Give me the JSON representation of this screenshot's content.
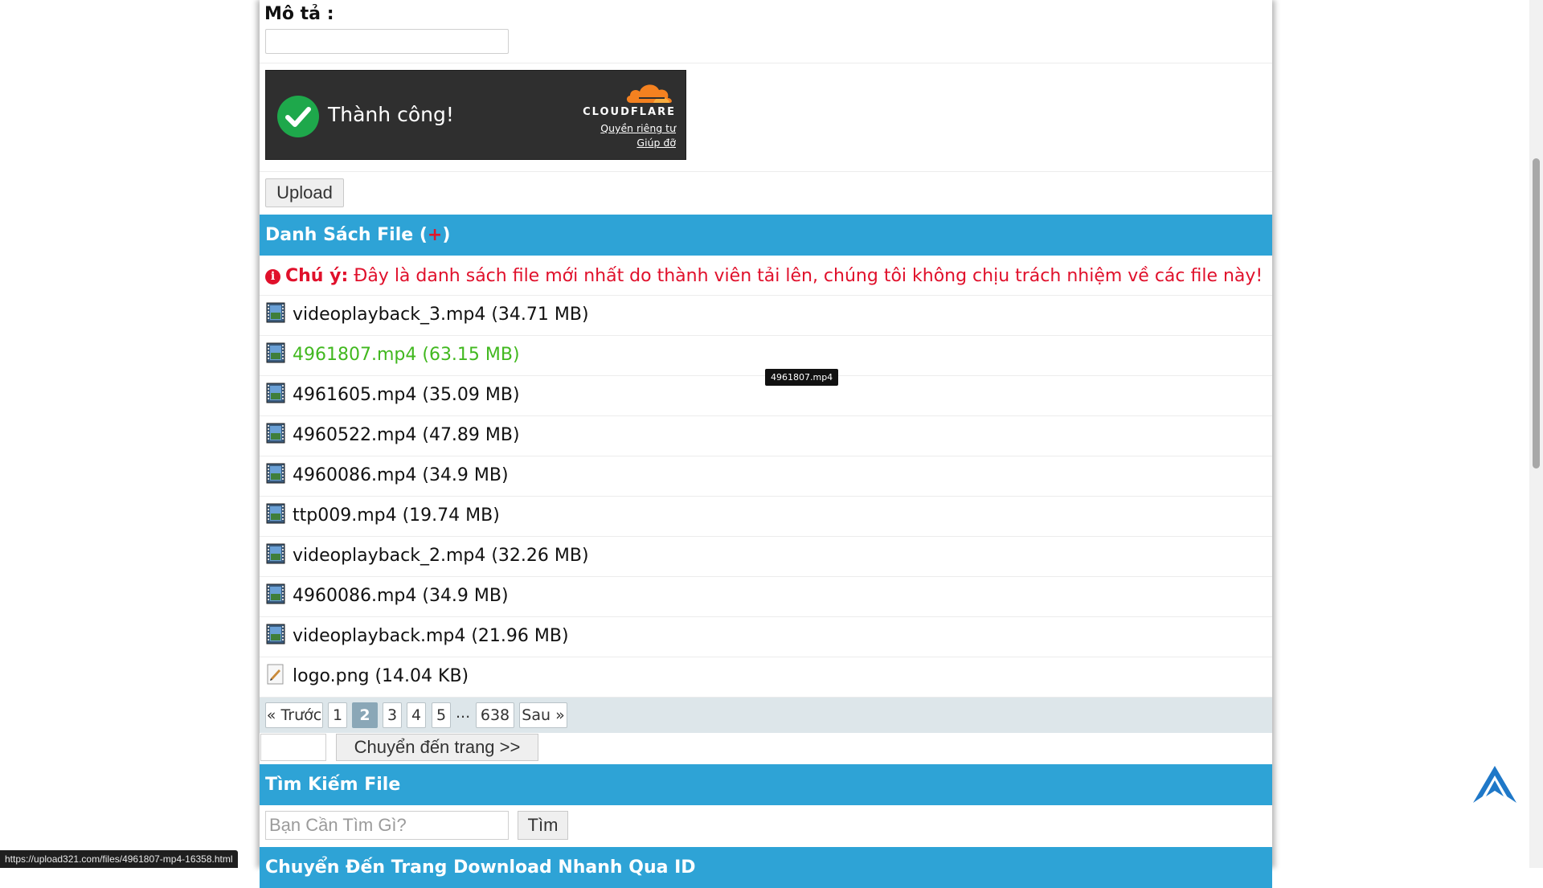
{
  "form": {
    "description_label": "Mô tả :",
    "description_value": "",
    "upload_label": "Upload"
  },
  "captcha": {
    "status": "Thành công!",
    "brand": "CLOUDFLARE",
    "privacy_link": "Quyền riêng tư",
    "help_link": "Giúp đỡ"
  },
  "file_list": {
    "title": "Danh Sách File (",
    "title_plus": "+",
    "title_end": ")",
    "notice_label": "Chú ý:",
    "notice_text": " Đây là danh sách file mới nhất do thành viên tải lên, chúng tôi không chịu trách nhiệm về các file này!",
    "files": [
      {
        "name": "videoplayback_3.mp4 (34.71 MB)",
        "type": "video-file-icon"
      },
      {
        "name": "4961807.mp4 (63.15 MB)",
        "type": "video-file-icon"
      },
      {
        "name": "4961605.mp4 (35.09 MB)",
        "type": "video-file-icon"
      },
      {
        "name": "4960522.mp4 (47.89 MB)",
        "type": "video-file-icon"
      },
      {
        "name": "4960086.mp4 (34.9 MB)",
        "type": "video-file-icon"
      },
      {
        "name": "ttp009.mp4 (19.74 MB)",
        "type": "video-file-icon"
      },
      {
        "name": "videoplayback_2.mp4 (32.26 MB)",
        "type": "video-file-icon"
      },
      {
        "name": "4960086.mp4 (34.9 MB)",
        "type": "video-file-icon"
      },
      {
        "name": "videoplayback.mp4 (21.96 MB)",
        "type": "video-file-icon"
      },
      {
        "name": "logo.png (14.04 KB)",
        "type": "image-file-icon"
      }
    ],
    "tooltip": "4961807.mp4"
  },
  "pagination": {
    "prev": "« Trước",
    "pages": [
      "1",
      "2",
      "3",
      "4",
      "5"
    ],
    "current": "2",
    "dots": "...",
    "last": "638",
    "next": "Sau »",
    "goto_value": "",
    "goto_label": "Chuyển đến trang >>"
  },
  "search": {
    "title": "Tìm Kiếm File",
    "placeholder": "Bạn Cần Tìm Gì?",
    "button": "Tìm"
  },
  "next_section": {
    "title": "Chuyển Đến Trang Download Nhanh Qua ID"
  },
  "status_bar": {
    "url": "https://upload321.com/files/4961807-mp4-16358.html"
  },
  "colors": {
    "section_header": "#2ea3d6",
    "notice": "#e0102b",
    "hover_link": "#41b81f",
    "active_page": "#8aa7b7"
  }
}
